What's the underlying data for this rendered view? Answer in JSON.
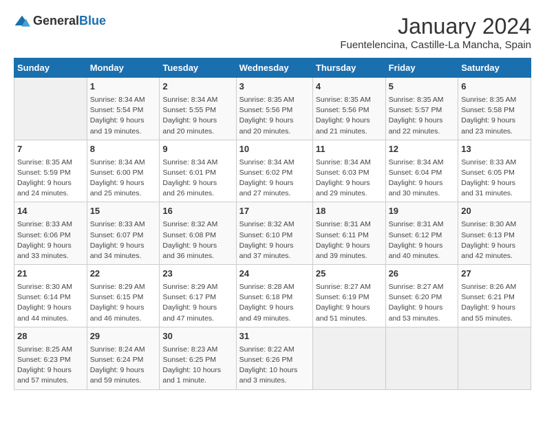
{
  "logo": {
    "general": "General",
    "blue": "Blue"
  },
  "header": {
    "month": "January 2024",
    "location": "Fuentelencina, Castille-La Mancha, Spain"
  },
  "days_of_week": [
    "Sunday",
    "Monday",
    "Tuesday",
    "Wednesday",
    "Thursday",
    "Friday",
    "Saturday"
  ],
  "weeks": [
    [
      {
        "day": "",
        "info": ""
      },
      {
        "day": "1",
        "info": "Sunrise: 8:34 AM\nSunset: 5:54 PM\nDaylight: 9 hours\nand 19 minutes."
      },
      {
        "day": "2",
        "info": "Sunrise: 8:34 AM\nSunset: 5:55 PM\nDaylight: 9 hours\nand 20 minutes."
      },
      {
        "day": "3",
        "info": "Sunrise: 8:35 AM\nSunset: 5:56 PM\nDaylight: 9 hours\nand 20 minutes."
      },
      {
        "day": "4",
        "info": "Sunrise: 8:35 AM\nSunset: 5:56 PM\nDaylight: 9 hours\nand 21 minutes."
      },
      {
        "day": "5",
        "info": "Sunrise: 8:35 AM\nSunset: 5:57 PM\nDaylight: 9 hours\nand 22 minutes."
      },
      {
        "day": "6",
        "info": "Sunrise: 8:35 AM\nSunset: 5:58 PM\nDaylight: 9 hours\nand 23 minutes."
      }
    ],
    [
      {
        "day": "7",
        "info": "Sunrise: 8:35 AM\nSunset: 5:59 PM\nDaylight: 9 hours\nand 24 minutes."
      },
      {
        "day": "8",
        "info": "Sunrise: 8:34 AM\nSunset: 6:00 PM\nDaylight: 9 hours\nand 25 minutes."
      },
      {
        "day": "9",
        "info": "Sunrise: 8:34 AM\nSunset: 6:01 PM\nDaylight: 9 hours\nand 26 minutes."
      },
      {
        "day": "10",
        "info": "Sunrise: 8:34 AM\nSunset: 6:02 PM\nDaylight: 9 hours\nand 27 minutes."
      },
      {
        "day": "11",
        "info": "Sunrise: 8:34 AM\nSunset: 6:03 PM\nDaylight: 9 hours\nand 29 minutes."
      },
      {
        "day": "12",
        "info": "Sunrise: 8:34 AM\nSunset: 6:04 PM\nDaylight: 9 hours\nand 30 minutes."
      },
      {
        "day": "13",
        "info": "Sunrise: 8:33 AM\nSunset: 6:05 PM\nDaylight: 9 hours\nand 31 minutes."
      }
    ],
    [
      {
        "day": "14",
        "info": "Sunrise: 8:33 AM\nSunset: 6:06 PM\nDaylight: 9 hours\nand 33 minutes."
      },
      {
        "day": "15",
        "info": "Sunrise: 8:33 AM\nSunset: 6:07 PM\nDaylight: 9 hours\nand 34 minutes."
      },
      {
        "day": "16",
        "info": "Sunrise: 8:32 AM\nSunset: 6:08 PM\nDaylight: 9 hours\nand 36 minutes."
      },
      {
        "day": "17",
        "info": "Sunrise: 8:32 AM\nSunset: 6:10 PM\nDaylight: 9 hours\nand 37 minutes."
      },
      {
        "day": "18",
        "info": "Sunrise: 8:31 AM\nSunset: 6:11 PM\nDaylight: 9 hours\nand 39 minutes."
      },
      {
        "day": "19",
        "info": "Sunrise: 8:31 AM\nSunset: 6:12 PM\nDaylight: 9 hours\nand 40 minutes."
      },
      {
        "day": "20",
        "info": "Sunrise: 8:30 AM\nSunset: 6:13 PM\nDaylight: 9 hours\nand 42 minutes."
      }
    ],
    [
      {
        "day": "21",
        "info": "Sunrise: 8:30 AM\nSunset: 6:14 PM\nDaylight: 9 hours\nand 44 minutes."
      },
      {
        "day": "22",
        "info": "Sunrise: 8:29 AM\nSunset: 6:15 PM\nDaylight: 9 hours\nand 46 minutes."
      },
      {
        "day": "23",
        "info": "Sunrise: 8:29 AM\nSunset: 6:17 PM\nDaylight: 9 hours\nand 47 minutes."
      },
      {
        "day": "24",
        "info": "Sunrise: 8:28 AM\nSunset: 6:18 PM\nDaylight: 9 hours\nand 49 minutes."
      },
      {
        "day": "25",
        "info": "Sunrise: 8:27 AM\nSunset: 6:19 PM\nDaylight: 9 hours\nand 51 minutes."
      },
      {
        "day": "26",
        "info": "Sunrise: 8:27 AM\nSunset: 6:20 PM\nDaylight: 9 hours\nand 53 minutes."
      },
      {
        "day": "27",
        "info": "Sunrise: 8:26 AM\nSunset: 6:21 PM\nDaylight: 9 hours\nand 55 minutes."
      }
    ],
    [
      {
        "day": "28",
        "info": "Sunrise: 8:25 AM\nSunset: 6:23 PM\nDaylight: 9 hours\nand 57 minutes."
      },
      {
        "day": "29",
        "info": "Sunrise: 8:24 AM\nSunset: 6:24 PM\nDaylight: 9 hours\nand 59 minutes."
      },
      {
        "day": "30",
        "info": "Sunrise: 8:23 AM\nSunset: 6:25 PM\nDaylight: 10 hours\nand 1 minute."
      },
      {
        "day": "31",
        "info": "Sunrise: 8:22 AM\nSunset: 6:26 PM\nDaylight: 10 hours\nand 3 minutes."
      },
      {
        "day": "",
        "info": ""
      },
      {
        "day": "",
        "info": ""
      },
      {
        "day": "",
        "info": ""
      }
    ]
  ]
}
